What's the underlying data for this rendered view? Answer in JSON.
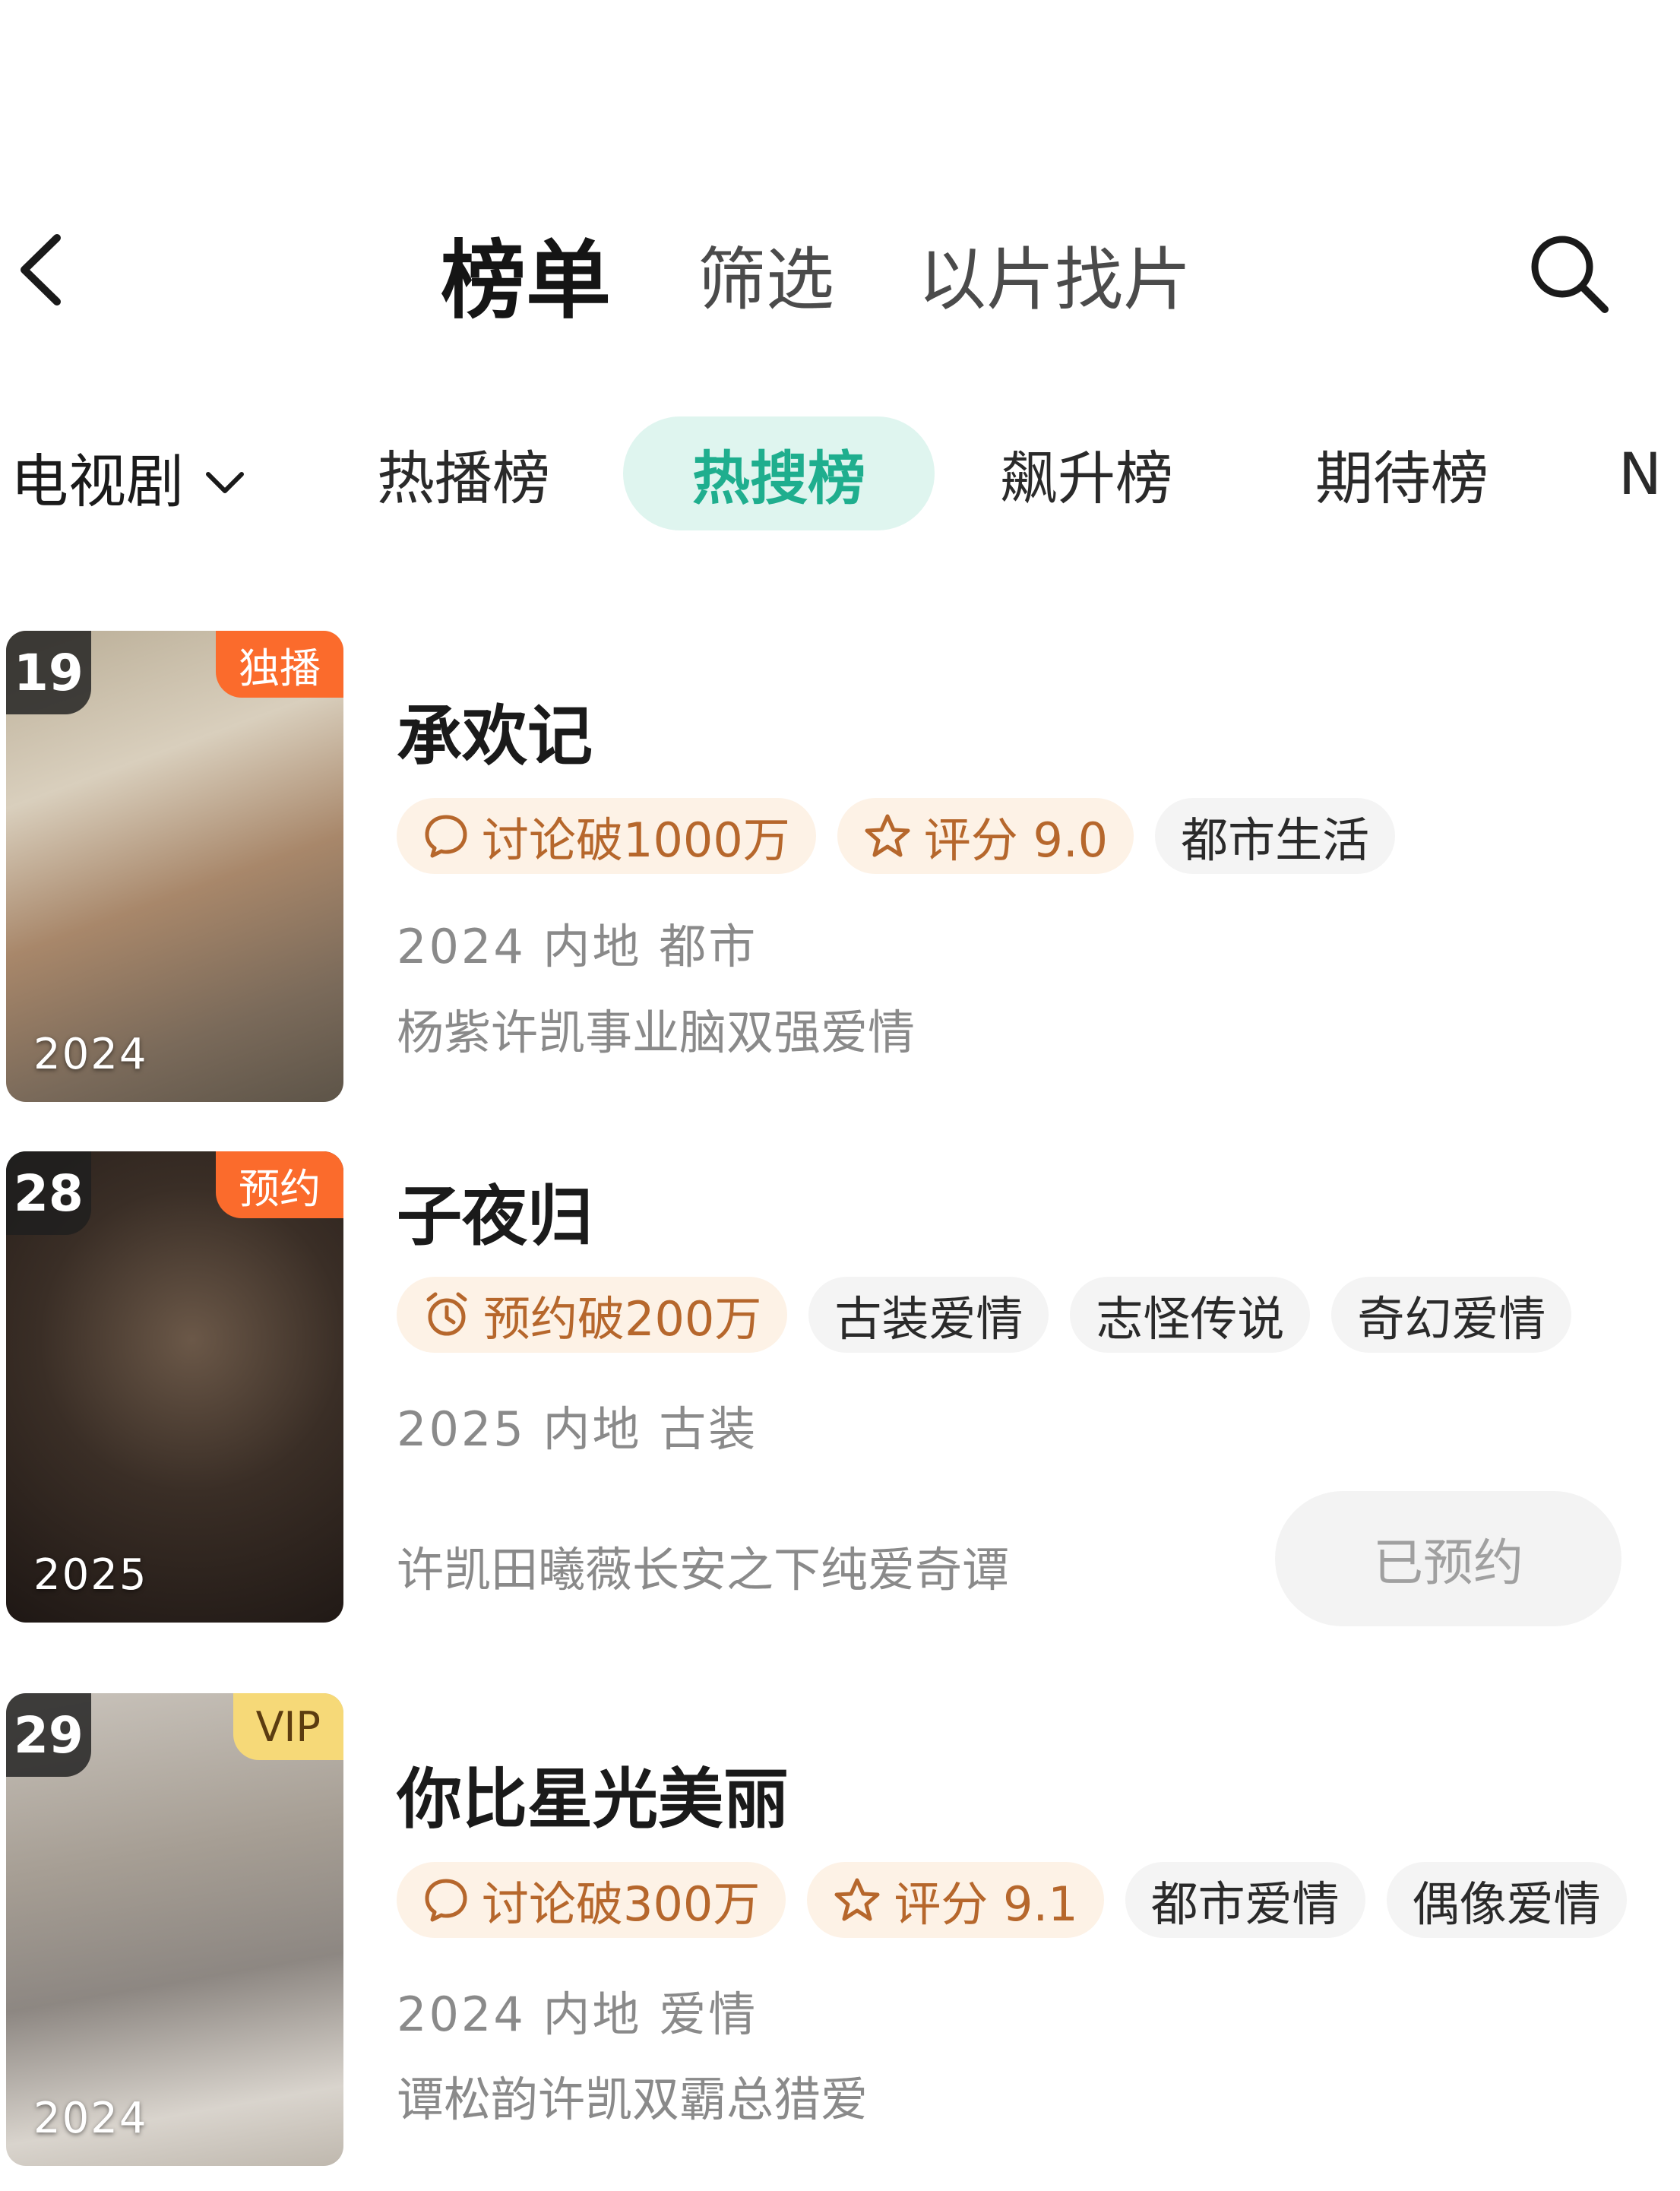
{
  "nav": {
    "tabs": [
      "榜单",
      "筛选",
      "以片找片"
    ]
  },
  "category": {
    "selected": "电视剧"
  },
  "rank_tabs": [
    "热播榜",
    "热搜榜",
    "飙升榜",
    "期待榜",
    "N"
  ],
  "rank_tabs_selected": "热搜榜",
  "colors": {
    "accent": "#1fae8e",
    "accent_bg": "#dff5ef",
    "badge_orange": "#fb6b2c",
    "badge_vip": "#f6d978",
    "tag_warm_text": "#b6672c"
  },
  "items": [
    {
      "rank": "19",
      "badge": "独播",
      "year": "2024",
      "title": "承欢记",
      "tags": [
        {
          "icon": "chat-bubble-icon",
          "text": "讨论破1000万"
        },
        {
          "icon": "star-icon",
          "text": "评分 9.0"
        },
        {
          "text": "都市生活"
        }
      ],
      "meta": "2024 内地 都市",
      "desc": "杨紫许凯事业脑双强爱情"
    },
    {
      "rank": "28",
      "badge": "预约",
      "year": "2025",
      "title": "子夜归",
      "tags": [
        {
          "icon": "alarm-clock-icon",
          "text": "预约破200万"
        },
        {
          "text": "古装爱情"
        },
        {
          "text": "志怪传说"
        },
        {
          "text": "奇幻爱情"
        }
      ],
      "meta": "2025 内地 古装",
      "desc": "许凯田曦薇长安之下纯爱奇谭",
      "action": "已预约"
    },
    {
      "rank": "29",
      "badge": "VIP",
      "year": "2024",
      "title": "你比星光美丽",
      "tags": [
        {
          "icon": "chat-bubble-icon",
          "text": "讨论破300万"
        },
        {
          "icon": "star-icon",
          "text": "评分 9.1"
        },
        {
          "text": "都市爱情"
        },
        {
          "text": "偶像爱情"
        }
      ],
      "meta": "2024 内地 爱情",
      "desc": "谭松韵许凯双霸总猎爱"
    }
  ]
}
